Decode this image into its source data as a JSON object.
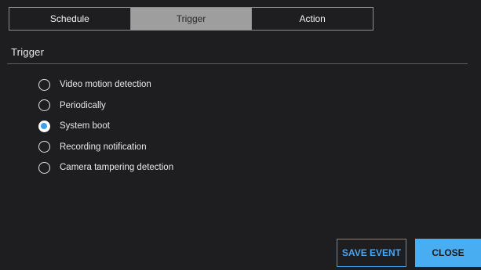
{
  "tabs": [
    {
      "label": "Schedule",
      "active": false
    },
    {
      "label": "Trigger",
      "active": true
    },
    {
      "label": "Action",
      "active": false
    }
  ],
  "section": {
    "title": "Trigger"
  },
  "trigger_options": [
    {
      "label": "Video motion detection",
      "selected": false
    },
    {
      "label": "Periodically",
      "selected": false
    },
    {
      "label": "System boot",
      "selected": true
    },
    {
      "label": "Recording notification",
      "selected": false
    },
    {
      "label": "Camera tampering detection",
      "selected": false
    }
  ],
  "buttons": {
    "save_label": "SAVE EVENT",
    "close_label": "CLOSE"
  },
  "colors": {
    "background": "#1e1e21",
    "active_tab": "#9e9e9e",
    "accent": "#49adf1",
    "radio_selected": "#3ca0ec"
  }
}
